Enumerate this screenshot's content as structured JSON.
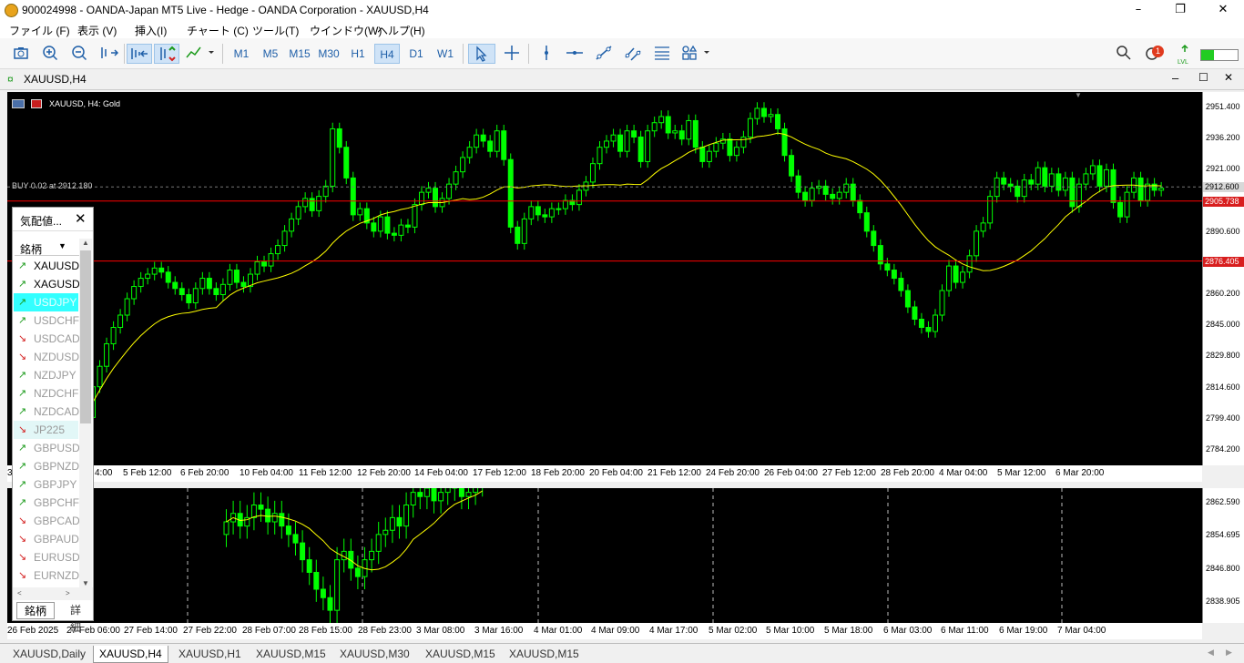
{
  "window": {
    "title": "900024998 - OANDA-Japan MT5 Live - Hedge - OANDA Corporation - XAUUSD,H4",
    "minimize": "–",
    "maximize": "❐",
    "close": "✕"
  },
  "menu": [
    "ファイル (F)",
    "表示 (V)",
    "挿入(I)",
    "チャート (C)",
    "ツール(T)",
    "ウインドウ(W)",
    "ヘルプ(H)"
  ],
  "toolbar": {
    "timeframes": [
      "M1",
      "M5",
      "M15",
      "M30",
      "H1",
      "H4",
      "D1",
      "W1"
    ],
    "selected_timeframe": "H4",
    "notification_count": "1",
    "lvl_label": "LVL"
  },
  "chart_window": {
    "title": "XAUUSD,H4",
    "info": "XAUUSD, H4:  Gold",
    "trade_line_label": "BUY 0.02 at 2912.180"
  },
  "market_watch": {
    "title": "気配値...",
    "column_header": "銘柄",
    "tab_symbols": "銘柄",
    "tab_details": "詳細",
    "symbols": [
      {
        "name": "XAUUSD",
        "dir": "up",
        "style": "bold"
      },
      {
        "name": "XAGUSD",
        "dir": "up",
        "style": "bold"
      },
      {
        "name": "USDJPY",
        "dir": "up",
        "style": "highlight"
      },
      {
        "name": "USDCHF",
        "dir": "up",
        "style": "dim"
      },
      {
        "name": "USDCAD",
        "dir": "down",
        "style": "dim"
      },
      {
        "name": "NZDUSD",
        "dir": "down",
        "style": "dim"
      },
      {
        "name": "NZDJPY",
        "dir": "up",
        "style": "dim"
      },
      {
        "name": "NZDCHF",
        "dir": "up",
        "style": "dim"
      },
      {
        "name": "NZDCAD",
        "dir": "up",
        "style": "dim"
      },
      {
        "name": "JP225",
        "dir": "down",
        "style": "light"
      },
      {
        "name": "GBPUSD",
        "dir": "up",
        "style": "dim"
      },
      {
        "name": "GBPNZD",
        "dir": "up",
        "style": "dim"
      },
      {
        "name": "GBPJPY",
        "dir": "up",
        "style": "dim"
      },
      {
        "name": "GBPCHF",
        "dir": "up",
        "style": "dim"
      },
      {
        "name": "GBPCAD",
        "dir": "down",
        "style": "dim"
      },
      {
        "name": "GBPAUD",
        "dir": "down",
        "style": "dim"
      },
      {
        "name": "EURUSD",
        "dir": "down",
        "style": "dim"
      },
      {
        "name": "EURNZD",
        "dir": "down",
        "style": "dim"
      }
    ]
  },
  "main_price_axis": [
    "2951.400",
    "2936.200",
    "2921.000",
    "2905.800",
    "2890.600",
    "2875.400",
    "2860.200",
    "2845.000",
    "2829.800",
    "2814.600",
    "2799.400",
    "2784.200"
  ],
  "price_tags": {
    "current": "2912.600",
    "line_upper": "2905.738",
    "line_lower": "2876.405"
  },
  "main_time_axis": [
    "3 ...",
    "4:00",
    "5 Feb 12:00",
    "6 Feb 20:00",
    "10 Feb 04:00",
    "11 Feb 12:00",
    "12 Feb 20:00",
    "14 Feb 04:00",
    "17 Feb 12:00",
    "18 Feb 20:00",
    "20 Feb 04:00",
    "21 Feb 12:00",
    "24 Feb 20:00",
    "26 Feb 04:00",
    "27 Feb 12:00",
    "28 Feb 20:00",
    "4 Mar 04:00",
    "5 Mar 12:00",
    "6 Mar 20:00"
  ],
  "sub_price_axis": [
    "2862.590",
    "2854.695",
    "2846.800",
    "2838.905"
  ],
  "sub_time_axis": [
    "26 Feb 2025",
    "27 Feb 06:00",
    "27 Feb 14:00",
    "27 Feb 22:00",
    "28 Feb 07:00",
    "28 Feb 15:00",
    "28 Feb 23:00",
    "3 Mar 08:00",
    "3 Mar 16:00",
    "4 Mar 01:00",
    "4 Mar 09:00",
    "4 Mar 17:00",
    "5 Mar 02:00",
    "5 Mar 10:00",
    "5 Mar 18:00",
    "6 Mar 03:00",
    "6 Mar 11:00",
    "6 Mar 19:00",
    "7 Mar 04:00"
  ],
  "bottom_tabs": [
    "XAUUSD,Daily",
    "XAUUSD,H4",
    "XAUUSD,H1",
    "XAUUSD,M15",
    "XAUUSD,M30",
    "XAUUSD,M15",
    "XAUUSD,M15"
  ],
  "active_tab": "XAUUSD,H4",
  "colors": {
    "bull": "#00ff00",
    "bear": "#00ff00",
    "ma": "#ffff00",
    "level_line": "#ff0000",
    "bg": "#000000",
    "dim_text": "#9a9a9a",
    "highlight": "#33ffff"
  },
  "chart_data": [
    {
      "type": "candlestick",
      "symbol": "XAUUSD",
      "timeframe": "H4",
      "ylim": [
        2776.6,
        2959.0
      ],
      "moving_average": true,
      "closes": [
        2800,
        2815,
        2825,
        2836,
        2844,
        2850,
        2858,
        2864,
        2868,
        2870,
        2873,
        2871,
        2866,
        2863,
        2860,
        2856,
        2863,
        2868,
        2863,
        2860,
        2865,
        2872,
        2866,
        2864,
        2870,
        2876,
        2874,
        2880,
        2884,
        2891,
        2897,
        2903,
        2907,
        2901,
        2908,
        2913,
        2941,
        2932,
        2917,
        2899,
        2902,
        2895,
        2891,
        2898,
        2890,
        2889,
        2894,
        2893,
        2904,
        2910,
        2912,
        2903,
        2907,
        2914,
        2920,
        2927,
        2932,
        2938,
        2935,
        2930,
        2940,
        2926,
        2893,
        2885,
        2897,
        2903,
        2899,
        2898,
        2902,
        2902,
        2906,
        2904,
        2911,
        2915,
        2924,
        2932,
        2935,
        2938,
        2930,
        2940,
        2937,
        2925,
        2940,
        2944,
        2947,
        2939,
        2940,
        2936,
        2945,
        2932,
        2925,
        2930,
        2934,
        2936,
        2928,
        2932,
        2937,
        2946,
        2951,
        2947,
        2948,
        2941,
        2928,
        2918,
        2910,
        2906,
        2912,
        2913,
        2909,
        2907,
        2910,
        2914,
        2906,
        2900,
        2891,
        2884,
        2875,
        2872,
        2868,
        2862,
        2854,
        2848,
        2844,
        2842,
        2850,
        2862,
        2874,
        2866,
        2871,
        2879,
        2891,
        2895,
        2908,
        2917,
        2914,
        2913,
        2908,
        2916,
        2914,
        2922,
        2913,
        2919,
        2911,
        2917,
        2903,
        2914,
        2919,
        2923,
        2913,
        2921,
        2905,
        2898,
        2910,
        2917,
        2906,
        2914,
        2911,
        2912
      ]
    },
    {
      "type": "candlestick",
      "symbol": "XAUUSD",
      "timeframe": "M15",
      "ylim": [
        2834.0,
        2866.0
      ],
      "moving_average": true,
      "closes": [
        2858,
        2860,
        2857,
        2859,
        2862,
        2861,
        2858,
        2860,
        2857,
        2855,
        2853,
        2849,
        2846,
        2842,
        2840,
        2837,
        2849,
        2851,
        2847,
        2845,
        2849,
        2851,
        2855,
        2856,
        2859,
        2857,
        2862,
        2865,
        2864,
        2866,
        2863,
        2865,
        2868,
        2866,
        2864,
        2865,
        2867,
        2869
      ]
    }
  ]
}
